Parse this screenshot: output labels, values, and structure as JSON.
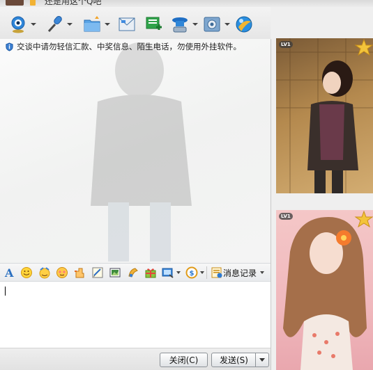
{
  "window": {
    "title_partial": "还是用这个Q吧"
  },
  "toolbar": {
    "items": [
      {
        "name": "video-call",
        "icon": "webcam-icon",
        "has_menu": true
      },
      {
        "name": "voice-call",
        "icon": "microphone-icon",
        "has_menu": true
      },
      {
        "name": "send-file",
        "icon": "folder-icon",
        "has_menu": true
      },
      {
        "name": "send-message",
        "icon": "envelope-icon",
        "has_menu": false
      },
      {
        "name": "create-group",
        "icon": "add-chat-icon",
        "has_menu": false
      },
      {
        "name": "remote-assist",
        "icon": "cap-user-icon",
        "has_menu": true
      },
      {
        "name": "apps",
        "icon": "gear-box-icon",
        "has_menu": true
      },
      {
        "name": "qq-zone",
        "icon": "orb-icon",
        "has_menu": false
      }
    ]
  },
  "history": {
    "notice": "交谈中请勿轻信汇款、中奖信息、陌生电话，勿使用外挂软件。"
  },
  "format_bar": {
    "items": [
      "font-icon",
      "smiley-icon",
      "magic-face-icon",
      "emoji-icon",
      "shake-icon",
      "handwriting-icon",
      "screenshot-icon",
      "image-icon",
      "music-icon",
      "gift-icon",
      "screen-capture-icon",
      "payment-icon"
    ],
    "message_history_label": "消息记录"
  },
  "input": {
    "value": ""
  },
  "buttons": {
    "close_label": "关闭(C)",
    "send_label": "发送(S)"
  },
  "show": {
    "top_level": "LV1",
    "bottom_level": "LV1"
  },
  "colors": {
    "accent_blue": "#2a7ad6",
    "star_gold": "#f3c43b"
  }
}
